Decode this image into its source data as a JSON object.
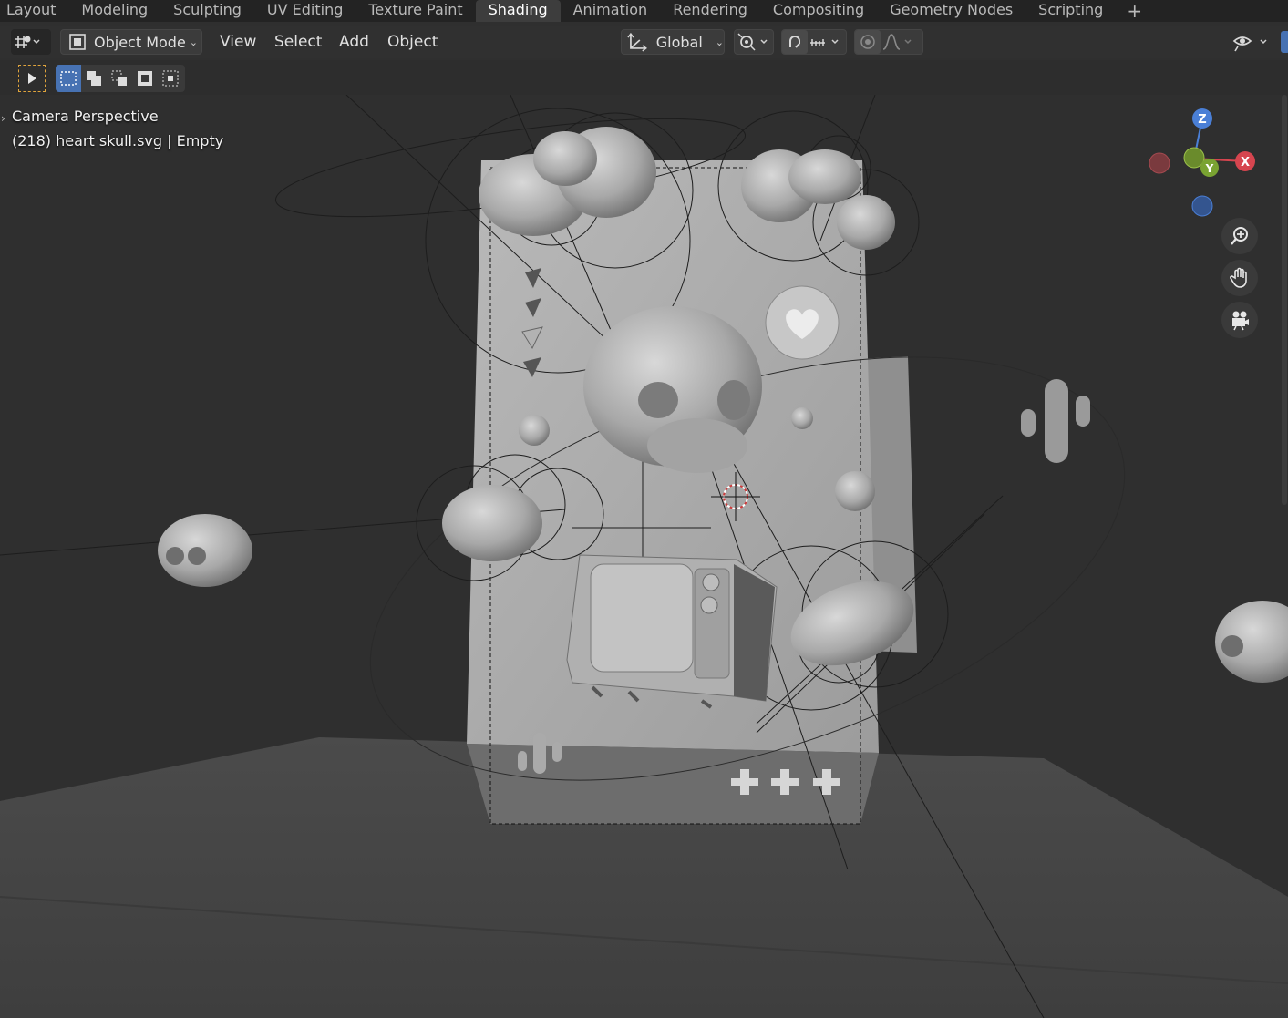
{
  "workspace_tabs": [
    {
      "label": "Layout",
      "active": false
    },
    {
      "label": "Modeling",
      "active": false
    },
    {
      "label": "Sculpting",
      "active": false
    },
    {
      "label": "UV Editing",
      "active": false
    },
    {
      "label": "Texture Paint",
      "active": false
    },
    {
      "label": "Shading",
      "active": true
    },
    {
      "label": "Animation",
      "active": false
    },
    {
      "label": "Rendering",
      "active": false
    },
    {
      "label": "Compositing",
      "active": false
    },
    {
      "label": "Geometry Nodes",
      "active": false
    },
    {
      "label": "Scripting",
      "active": false
    }
  ],
  "add_tab_label": "+",
  "header": {
    "editor_type_icon": "viewport-grid-icon",
    "mode_label": "Object Mode",
    "menus": {
      "view": "View",
      "select": "Select",
      "add": "Add",
      "object": "Object"
    },
    "transform_orientation": "Global",
    "pivot_icon": "pivot-icon",
    "snap_icon": "magnet-icon",
    "snap_increment_icon": "snap-increment-icon",
    "proportional_icon": "proportional-edit-icon",
    "falloff_icon": "falloff-curve-icon",
    "visibility_icon": "eye-icon"
  },
  "toolbar": {
    "select_tool_icon": "cursor-select-icon",
    "modes": [
      {
        "icon": "mode-set-icon",
        "active": true
      },
      {
        "icon": "mode-extend-icon",
        "active": false
      },
      {
        "icon": "mode-subtract-icon",
        "active": false
      },
      {
        "icon": "mode-difference-icon",
        "active": false
      },
      {
        "icon": "mode-intersect-icon",
        "active": false
      }
    ]
  },
  "viewport": {
    "view_name": "Camera Perspective",
    "active_object": "(218) heart skull.svg | Empty",
    "gizmo": {
      "z": "Z",
      "y": "Y",
      "x": "X"
    },
    "nav_buttons": [
      "zoom-icon",
      "hand-pan-icon",
      "camera-view-icon"
    ],
    "colors": {
      "x_axis": "#d6454f",
      "y_axis": "#7aa332",
      "z_axis": "#4a7fd6",
      "accent": "#4772b3",
      "active_tab": "#3d3d3d",
      "background": "#2f2f2f"
    }
  }
}
